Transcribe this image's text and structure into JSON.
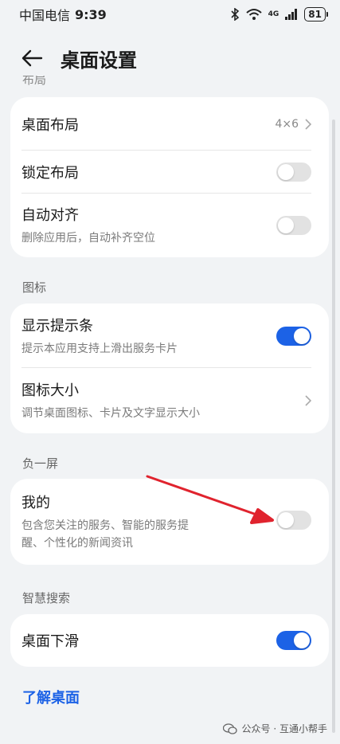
{
  "status_bar": {
    "carrier": "中国电信",
    "time": "9:39",
    "network": "4G",
    "battery": "81"
  },
  "header": {
    "title": "桌面设置"
  },
  "sections": {
    "layout": {
      "header_cut": "布局",
      "items": [
        {
          "title": "桌面布局",
          "value": "4×6"
        },
        {
          "title": "锁定布局",
          "toggle": false
        },
        {
          "title": "自动对齐",
          "subtitle": "删除应用后，自动补齐空位",
          "toggle": false
        }
      ]
    },
    "icons": {
      "header": "图标",
      "items": [
        {
          "title": "显示提示条",
          "subtitle": "提示本应用支持上滑出服务卡片",
          "toggle": true
        },
        {
          "title": "图标大小",
          "subtitle": "调节桌面图标、卡片及文字显示大小"
        }
      ]
    },
    "minus_one": {
      "header": "负一屏",
      "items": [
        {
          "title": "我的",
          "subtitle_line1": "包含您关注的服务、智能的服务提",
          "subtitle_line2": "醒、个性化的新闻资讯",
          "toggle": false
        }
      ]
    },
    "smart_search": {
      "header": "智慧搜索",
      "items": [
        {
          "title": "桌面下滑",
          "toggle": true
        }
      ]
    }
  },
  "footer": {
    "link": "了解桌面",
    "watermark": "公众号 · 互通小帮手"
  },
  "colors": {
    "accent": "#1c62e6",
    "annotation_arrow": "#e0232e"
  }
}
